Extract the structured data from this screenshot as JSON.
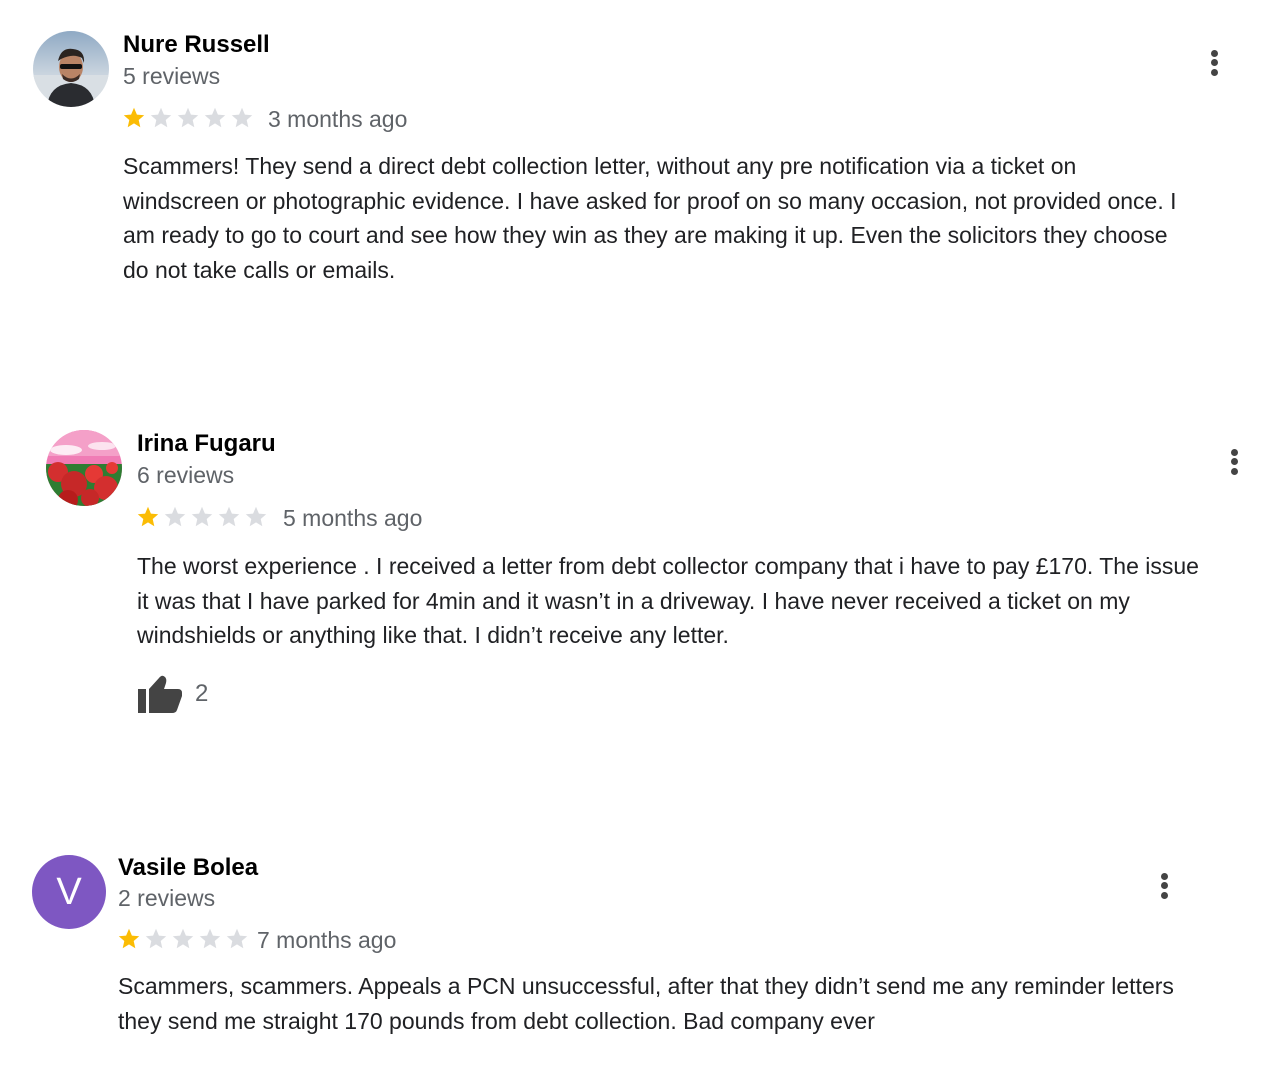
{
  "reviews": [
    {
      "name": "Nure Russell",
      "review_count": "5 reviews",
      "rating": 1,
      "date": "3 months ago",
      "lines": [
        "Scammers! They send a direct debt collection letter, without any pre notification via a ticket on",
        "windscreen or photographic evidence. I have asked for proof on so many occasion, not provided once. I",
        "am ready to go to court and see how they win as they are making it up. Even the solicitors they choose",
        "do not take calls or emails."
      ]
    },
    {
      "name": "Irina Fugaru",
      "review_count": "6 reviews",
      "rating": 1,
      "date": "5 months ago",
      "lines": [
        "The worst experience . I received a letter from debt collector company that i have to pay £170. The issue",
        "it was that I have parked for 4min and it wasn’t in a driveway. I have never received a ticket on my",
        "windshields or anything like that. I didn’t receive any letter."
      ],
      "helpful_count": "2"
    },
    {
      "name": "Vasile Bolea",
      "review_count": "2 reviews",
      "rating": 1,
      "date": "7 months ago",
      "avatar_letter": "V",
      "lines": [
        "Scammers, scammers. Appeals a PCN unsuccessful, after that they didn’t send me any reminder letters",
        "they send me straight 170 pounds from debt collection. Bad company ever"
      ]
    }
  ],
  "colors": {
    "star_filled": "#fbbc04",
    "star_empty": "#dadce0",
    "letter_avatar_bg": "#7e57c2"
  }
}
